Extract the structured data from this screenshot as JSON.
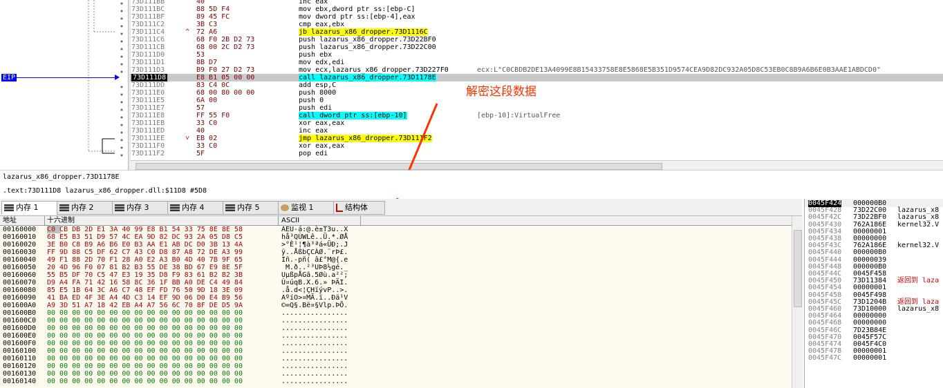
{
  "disasm": {
    "lines": [
      {
        "addr": "73D111BB",
        "bytes": "40",
        "instr": "inc eax",
        "comment": ""
      },
      {
        "addr": "73D111BC",
        "bytes": "88 5D F4",
        "instr": "mov ebx,dword ptr ss:[ebp-C]",
        "comment": ""
      },
      {
        "addr": "73D111BF",
        "bytes": "89 45 FC",
        "instr": "mov dword ptr ss:[ebp-4],eax",
        "comment": ""
      },
      {
        "addr": "73D111C2",
        "bytes": "3B C3",
        "instr": "cmp eax,ebx",
        "comment": ""
      },
      {
        "addr": "73D111C4",
        "bytes": "72 A6",
        "instr": "jb lazarus_x86_dropper.73D1116C",
        "comment": "",
        "mark": "^",
        "kw": "jb"
      },
      {
        "addr": "73D111C6",
        "bytes": "68 F0 2B D2 73",
        "instr": "push lazarus_x86_dropper.73D22BF0",
        "comment": ""
      },
      {
        "addr": "73D111CB",
        "bytes": "68 00 2C D2 73",
        "instr": "push lazarus_x86_dropper.73D22C00",
        "comment": ""
      },
      {
        "addr": "73D111D0",
        "bytes": "53",
        "instr": "push ebx",
        "comment": ""
      },
      {
        "addr": "73D111D1",
        "bytes": "8B D7",
        "instr": "mov edx,edi",
        "comment": ""
      },
      {
        "addr": "73D111D3",
        "bytes": "B9 F0 27 D2 73",
        "instr": "mov ecx,lazarus_x86_dropper.73D227F0",
        "comment": "ecx:L\"C0CBDB2DE13A4099E8B15433758E8E5868E5B351D9574CEA9D82DC932A05D8C53EB0C8B9A6B6E0B3AAE1ABDCD0\""
      },
      {
        "addr": "73D111D8",
        "bytes": "E8 B1 05 00 00",
        "instr": "call lazarus_x86_dropper.73D1178E",
        "comment": "",
        "current": true,
        "kw": "call"
      },
      {
        "addr": "73D111DD",
        "bytes": "83 C4 0C",
        "instr": "add esp,C",
        "comment": ""
      },
      {
        "addr": "73D111E0",
        "bytes": "68 00 80 00 00",
        "instr": "push 8000",
        "comment": ""
      },
      {
        "addr": "73D111E5",
        "bytes": "6A 00",
        "instr": "push 0",
        "comment": ""
      },
      {
        "addr": "73D111E7",
        "bytes": "57",
        "instr": "push edi",
        "comment": ""
      },
      {
        "addr": "73D111E8",
        "bytes": "FF 55 F0",
        "instr": "call dword ptr ss:[ebp-10]",
        "comment": "[ebp-10]:VirtualFree",
        "kw": "call"
      },
      {
        "addr": "73D111EB",
        "bytes": "33 C0",
        "instr": "xor eax,eax",
        "comment": ""
      },
      {
        "addr": "73D111ED",
        "bytes": "40",
        "instr": "inc eax",
        "comment": ""
      },
      {
        "addr": "73D111EE",
        "bytes": "EB 02",
        "instr": "jmp lazarus_x86_dropper.73D111F2",
        "comment": "",
        "mark": "v",
        "kw": "jmp"
      },
      {
        "addr": "73D111F0",
        "bytes": "33 C0",
        "instr": "xor eax,eax",
        "comment": ""
      },
      {
        "addr": "73D111F2",
        "bytes": "5F",
        "instr": "pop edi",
        "comment": ""
      }
    ],
    "eip_label": "EIP",
    "annotation": "解密这段数据"
  },
  "info": {
    "line1": "lazarus_x86_dropper.73D1178E",
    "line2": ".text:73D111D8 lazarus_x86_dropper.dll:$11D8 #5D8"
  },
  "tabs": [
    {
      "label": "内存 1",
      "icon": "memory-icon",
      "active": true
    },
    {
      "label": "内存 2",
      "icon": "memory-icon"
    },
    {
      "label": "内存 3",
      "icon": "memory-icon"
    },
    {
      "label": "内存 4",
      "icon": "memory-icon"
    },
    {
      "label": "内存 5",
      "icon": "memory-icon"
    },
    {
      "label": "监视 1",
      "icon": "watch-icon"
    },
    {
      "label": "结构体",
      "icon": "struct-icon"
    }
  ],
  "memory": {
    "headers": {
      "addr": "地址",
      "hex": "十六进制",
      "ascii": "ASCII"
    },
    "rows": [
      {
        "addr": "00160000",
        "hex": "C0 CB DB 2D E1 3A 40 99 E8 B1 54 33 75 8E 8E 58",
        "ascii": "ÀËÛ-á:@.è±T3u..X"
      },
      {
        "addr": "00160010",
        "hex": "68 E5 B3 51 D9 57 4C EA 9D 82 DC 93 2A 05 D8 C5",
        "ascii": "hå³QÙWLê..Ü.*.ØÅ"
      },
      {
        "addr": "00160020",
        "hex": "3E B0 C8 B9 A6 B6 E0 B3 AA E1 AB DC D0 3B 13 4A",
        "ascii": ">°È¹¦¶à³ªá«ÜÐ;.J"
      },
      {
        "addr": "00160030",
        "hex": "FF 9D 88 C5 DF 62 C7 43 C0 D8 87 A8 72 DE A3 99",
        "ascii": "ÿ..ÅßbÇCÀØ.¨rÞ£."
      },
      {
        "addr": "00160040",
        "hex": "49 F1 88 2D 70 F1 28 A0 E2 A3 B0 4D 40 7B 9F 65",
        "ascii": "Iñ.-pñ( â£°M@{.e"
      },
      {
        "addr": "00160050",
        "hex": "20 4D 96 F0 07 81 B2 B3 55 DE 38 BD 67 E9 8E 5F",
        "ascii": " M.ð..²³UÞ8½gé._"
      },
      {
        "addr": "00160060",
        "hex": "55 B5 DF 70 C5 47 E3 19 35 D8 F9 83 61 B2 B2 3B",
        "ascii": "UµßpÅGã.5Øù.a²²;"
      },
      {
        "addr": "00160070",
        "hex": "D9 A4 FA 71 42 16 58 8C 36 1F BB A0 DE C4 49 84",
        "ascii": "Ù¤úqB.X.6.» ÞÄI."
      },
      {
        "addr": "00160080",
        "hex": "85 E5 1B 64 3C A6 C7 48 EF FD 76 50 9D 18 3E 09",
        "ascii": ".å.d<¦ÇHïývP..>."
      },
      {
        "addr": "00160090",
        "hex": "41 BA ED 4F 3E A4 4D C3 14 EF 9D 06 D0 E4 B9 56",
        "ascii": "AºíO>¤MÃ.ï..Ðä¹V"
      },
      {
        "addr": "001600A0",
        "hex": "A9 3D 51 A7 18 42 EB A4 A7 56 6C 70 8F DE D5 9A",
        "ascii": "©=Q§.Bë¤§Vlp.ÞÕ."
      },
      {
        "addr": "001600B0",
        "hex": "00 00 00 00 00 00 00 00 00 00 00 00 00 00 00 00",
        "ascii": "................"
      },
      {
        "addr": "001600C0",
        "hex": "00 00 00 00 00 00 00 00 00 00 00 00 00 00 00 00",
        "ascii": "................"
      },
      {
        "addr": "001600D0",
        "hex": "00 00 00 00 00 00 00 00 00 00 00 00 00 00 00 00",
        "ascii": "................"
      },
      {
        "addr": "001600E0",
        "hex": "00 00 00 00 00 00 00 00 00 00 00 00 00 00 00 00",
        "ascii": "................"
      },
      {
        "addr": "001600F0",
        "hex": "00 00 00 00 00 00 00 00 00 00 00 00 00 00 00 00",
        "ascii": "................"
      },
      {
        "addr": "00160100",
        "hex": "00 00 00 00 00 00 00 00 00 00 00 00 00 00 00 00",
        "ascii": "................"
      },
      {
        "addr": "00160110",
        "hex": "00 00 00 00 00 00 00 00 00 00 00 00 00 00 00 00",
        "ascii": "................"
      },
      {
        "addr": "00160120",
        "hex": "00 00 00 00 00 00 00 00 00 00 00 00 00 00 00 00",
        "ascii": "................"
      },
      {
        "addr": "00160130",
        "hex": "00 00 00 00 00 00 00 00 00 00 00 00 00 00 00 00",
        "ascii": "................"
      },
      {
        "addr": "00160140",
        "hex": "00 00 00 00 00 00 00 00 00 00 00 00 00 00 00 00",
        "ascii": "................"
      }
    ]
  },
  "stack": {
    "rows": [
      {
        "addr": "0045F424",
        "value": "000000B0",
        "comment": "",
        "top": true
      },
      {
        "addr": "0045F428",
        "value": "73D22C00",
        "comment": "lazarus_x8"
      },
      {
        "addr": "0045F42C",
        "value": "73D22BF0",
        "comment": "lazarus_x8"
      },
      {
        "addr": "0045F430",
        "value": "762A186E",
        "comment": "kernel32.V"
      },
      {
        "addr": "0045F434",
        "value": "00000001",
        "comment": ""
      },
      {
        "addr": "0045F438",
        "value": "00000000",
        "comment": ""
      },
      {
        "addr": "0045F43C",
        "value": "762A186E",
        "comment": "kernel32.V"
      },
      {
        "addr": "0045F440",
        "value": "000000B0",
        "comment": ""
      },
      {
        "addr": "0045F444",
        "value": "00000039",
        "comment": ""
      },
      {
        "addr": "0045F448",
        "value": "000000B0",
        "comment": ""
      },
      {
        "addr": "0045F44C",
        "value": "0045F458",
        "comment": ""
      },
      {
        "addr": "0045F450",
        "value": "73D11384",
        "comment": "返回到 laza",
        "red": true
      },
      {
        "addr": "0045F454",
        "value": "00000001",
        "comment": ""
      },
      {
        "addr": "0045F458",
        "value": "0045F498",
        "comment": ""
      },
      {
        "addr": "0045F45C",
        "value": "73D1204B",
        "comment": "返回到 laza",
        "red": true
      },
      {
        "addr": "0045F460",
        "value": "73D10000",
        "comment": "lazarus_x8"
      },
      {
        "addr": "0045F464",
        "value": "00000000",
        "comment": ""
      },
      {
        "addr": "0045F468",
        "value": "00000000",
        "comment": ""
      },
      {
        "addr": "0045F46C",
        "value": "7D23B84E",
        "comment": ""
      },
      {
        "addr": "0045F470",
        "value": "0045F57C",
        "comment": ""
      },
      {
        "addr": "0045F474",
        "value": "0045F4C0",
        "comment": ""
      },
      {
        "addr": "0045F478",
        "value": "00000001",
        "comment": ""
      },
      {
        "addr": "0045F47C",
        "value": "00000001",
        "comment": ""
      }
    ]
  },
  "colors": {
    "eip": "#0000ff",
    "annotation": "#ff3300",
    "call_bg": "#00ffff",
    "jmp_bg": "#ffff00",
    "hex_bg": "#fffaf0"
  }
}
